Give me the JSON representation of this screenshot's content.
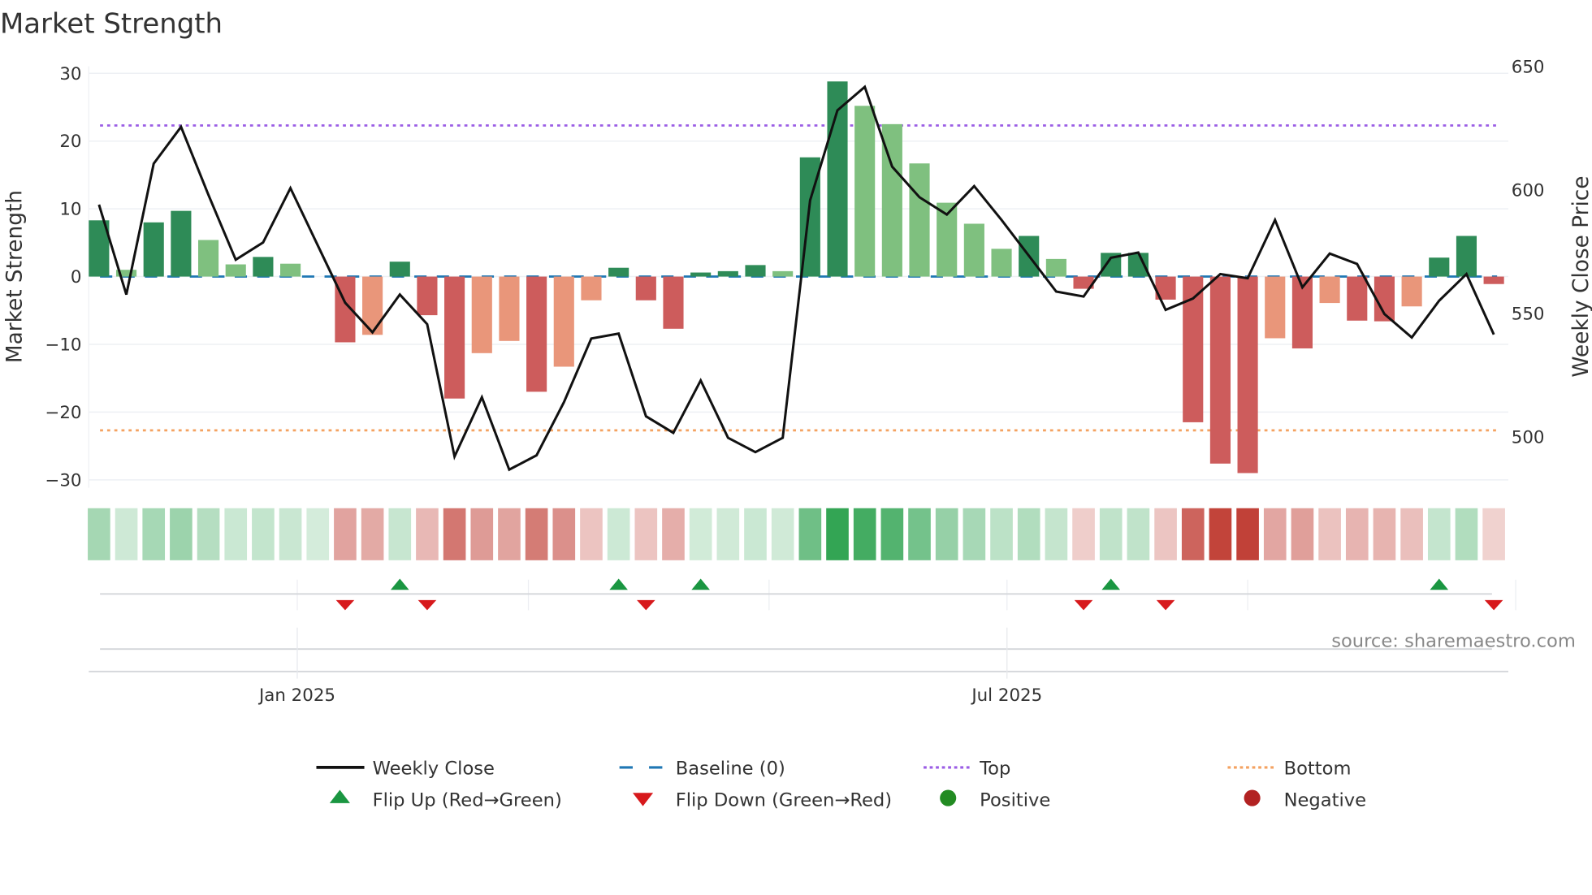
{
  "chart_data": {
    "type": "bar",
    "title": "Market Strength",
    "ylabel": "Market Strength",
    "y2label": "Weekly Close Price",
    "ylim": [
      -31,
      30.5
    ],
    "y2lim": [
      480,
      652
    ],
    "yticks": [
      30,
      20,
      10,
      0,
      -10,
      -20,
      -30
    ],
    "yticklabels": [
      "30",
      "20",
      "10",
      "0",
      "−10",
      "−20",
      "−30"
    ],
    "y2ticks": [
      650,
      600,
      550,
      500
    ],
    "xticks": [
      {
        "label": "Jan 2025",
        "week_index": 7.25
      },
      {
        "label": "Jul 2025",
        "week_index": 33.2
      }
    ],
    "top_level": 22.3,
    "bottom_level": -22.7,
    "baseline": 0,
    "strength": [
      8.3,
      1.0,
      8.0,
      9.7,
      5.4,
      1.8,
      2.9,
      1.9,
      0,
      -9.7,
      -8.6,
      2.2,
      -5.7,
      -18.0,
      -11.3,
      -9.5,
      -17.0,
      -13.3,
      -3.5,
      1.3,
      -3.5,
      -7.7,
      0.6,
      0.8,
      1.7,
      0.8,
      17.6,
      28.8,
      25.2,
      22.5,
      16.7,
      10.9,
      7.8,
      4.1,
      6.0,
      2.6,
      -1.8,
      3.5,
      3.5,
      -3.4,
      -21.5,
      -27.6,
      -29.0,
      -9.1,
      -10.6,
      -3.9,
      -6.5,
      -6.6,
      -4.4,
      2.8,
      6.0,
      -1.1
    ],
    "strong": [
      1,
      0,
      1,
      1,
      0,
      0,
      1,
      0,
      1,
      1,
      0,
      1,
      1,
      1,
      0,
      0,
      1,
      0,
      0,
      1,
      1,
      1,
      1,
      1,
      1,
      0,
      1,
      1,
      0,
      0,
      0,
      0,
      0,
      0,
      1,
      0,
      1,
      1,
      1,
      1,
      1,
      1,
      1,
      0,
      1,
      0,
      1,
      1,
      0,
      1,
      1,
      1
    ],
    "weekly_close": [
      594,
      557.6,
      610.6,
      625.5,
      598,
      571.7,
      578.7,
      600.7,
      577.5,
      554.3,
      542.3,
      557.6,
      545.6,
      492,
      516,
      486.7,
      492.5,
      514,
      539.8,
      541.8,
      508.3,
      501.6,
      522.8,
      499.6,
      493.8,
      499.6,
      595.7,
      632.2,
      641.7,
      609.4,
      597,
      590,
      601.5,
      587.8,
      573.3,
      558.8,
      556.8,
      572.5,
      574.6,
      551.4,
      556,
      565.9,
      564.2,
      587.8,
      560.5,
      574.2,
      570,
      549.7,
      540.2,
      555.1,
      565.9,
      541.4
    ],
    "flip_up_weeks": [
      11,
      19,
      22,
      37,
      49
    ],
    "flip_down_weeks": [
      9,
      12,
      20,
      36,
      39,
      51
    ],
    "month_gridlines": [
      7.25,
      15.7,
      24.5,
      33.2,
      42.0,
      51.8
    ],
    "legend": {
      "placement": "bottom",
      "items": [
        {
          "label": "Weekly Close",
          "kind": "line"
        },
        {
          "label": "Baseline (0)",
          "kind": "dash"
        },
        {
          "label": "Top",
          "kind": "dot-top"
        },
        {
          "label": "Bottom",
          "kind": "dot-bottom"
        },
        {
          "label": "Flip Up (Red→Green)",
          "kind": "tri-up"
        },
        {
          "label": "Flip Down (Green→Red)",
          "kind": "tri-down"
        },
        {
          "label": "Positive",
          "kind": "circle-pos"
        },
        {
          "label": "Negative",
          "kind": "circle-neg"
        }
      ]
    },
    "source": "source: sharemaestro.com",
    "colors": {
      "pos_strong": "#2e8b57",
      "pos_weak": "#7fc07f",
      "neg_strong": "#cd5c5c",
      "neg_weak": "#e9967a",
      "top": "#9b5de5",
      "bottom": "#f4a261",
      "baseline": "#1f77b4",
      "close": "#111111",
      "flip_up": "#1a9641",
      "flip_down": "#d7191c",
      "positive": "#228b22",
      "negative": "#b22222"
    }
  }
}
